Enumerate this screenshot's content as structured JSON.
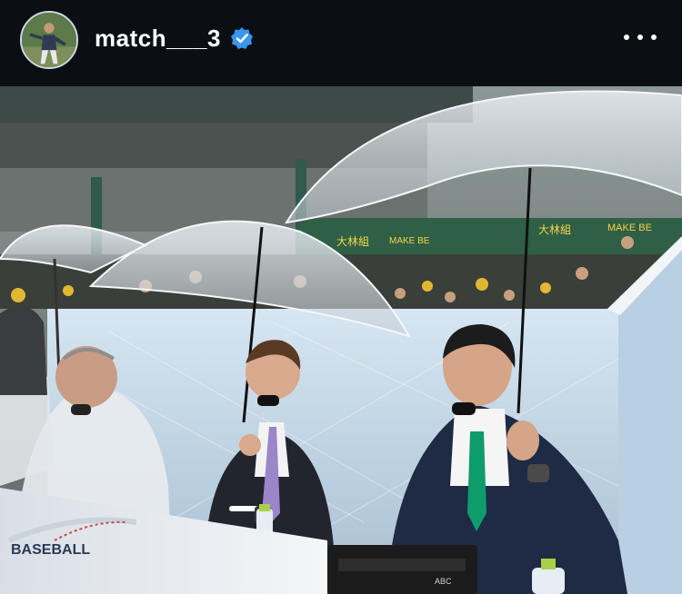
{
  "post": {
    "username": "match___3",
    "verified": true,
    "avatar_icon": "profile-photo-baseball-player",
    "menu_icon": "more-options-icon"
  },
  "photo": {
    "scene_text": {
      "banner_left": "大林組",
      "banner_mid": "MAKE BE",
      "banner_right": "大林組",
      "banner_far": "MAKE BE",
      "desk_logo": "BASEBALL",
      "panel_logo": "ABC"
    }
  },
  "colors": {
    "header_bg": "#0b0f14",
    "verified_blue": "#3897f0",
    "tie_green": "#0f9c6b",
    "tie_purple": "#9a86c9"
  }
}
